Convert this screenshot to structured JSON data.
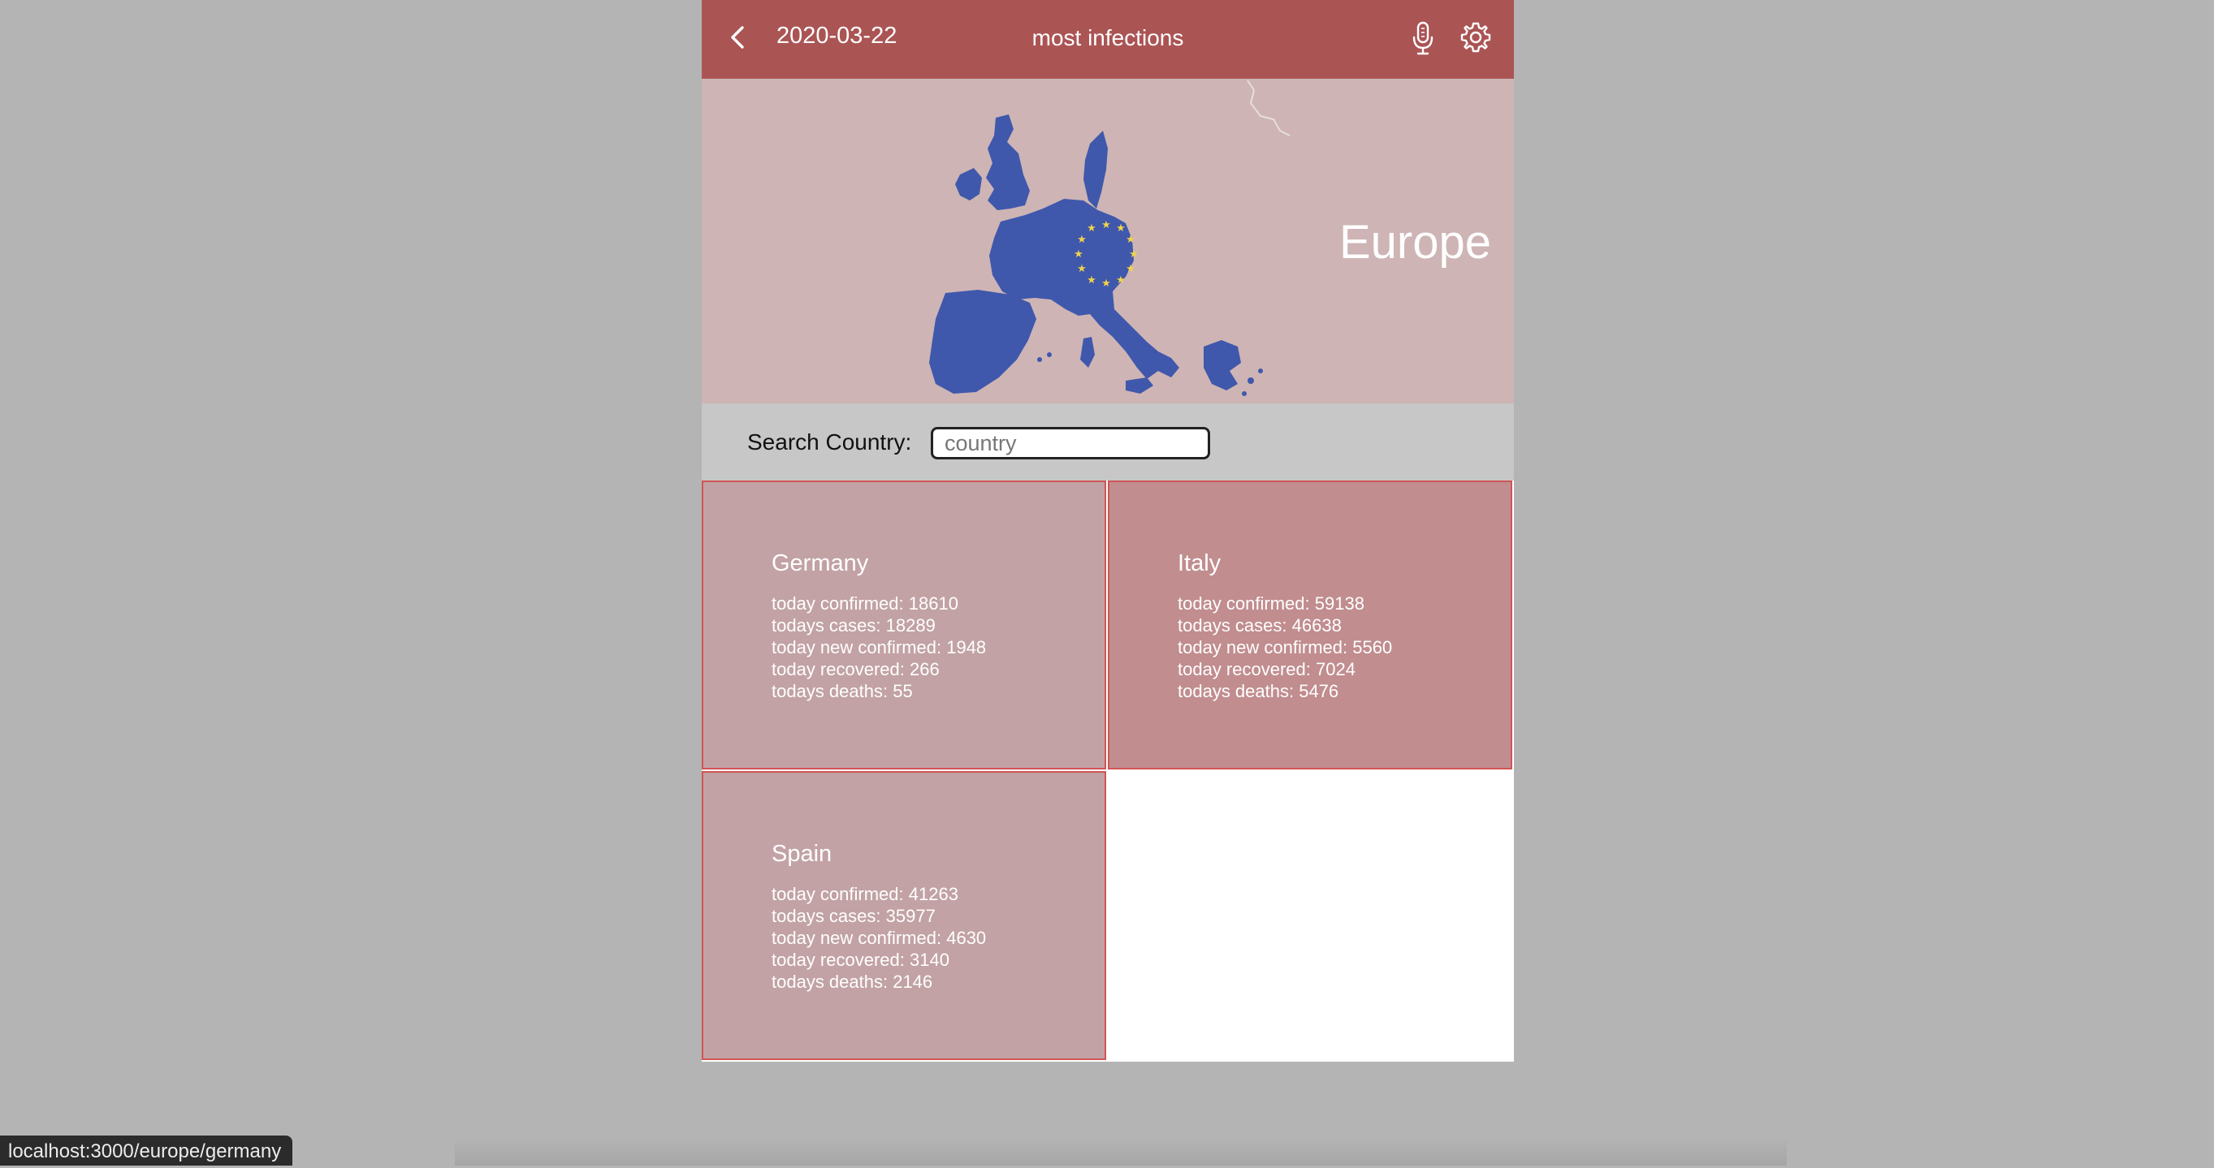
{
  "header": {
    "date": "2020-03-22",
    "title": "most infections",
    "icons": [
      "chevron-left-icon",
      "microphone-icon",
      "gear-icon"
    ]
  },
  "hero": {
    "region": "Europe",
    "image": "europe-map-eu-flag"
  },
  "search": {
    "label": "Search Country:",
    "placeholder": "country",
    "value": ""
  },
  "countries": [
    {
      "name": "Germany",
      "stats": [
        "today confirmed: 18610",
        "todays cases: 18289",
        "today new confirmed: 1948",
        "today recovered: 266",
        "todays deaths: 55"
      ]
    },
    {
      "name": "Italy",
      "stats": [
        "today confirmed: 59138",
        "todays cases: 46638",
        "today new confirmed: 5560",
        "today recovered: 7024",
        "todays deaths: 5476"
      ]
    },
    {
      "name": "Spain",
      "stats": [
        "today confirmed: 41263",
        "todays cases: 35977",
        "today new confirmed: 4630",
        "today recovered: 3140",
        "todays deaths: 2146"
      ]
    }
  ],
  "status_bar": {
    "url": "localhost:3000/europe/germany"
  },
  "colors": {
    "header": "#ab5454",
    "hero_bg": "#ceb4b5",
    "map_fill": "#3f58ab",
    "stars": "#f2d24a",
    "card_border": "#d15555",
    "card_bg": "#c2a2a4",
    "card_bg_highlight": "#c18d8f"
  }
}
